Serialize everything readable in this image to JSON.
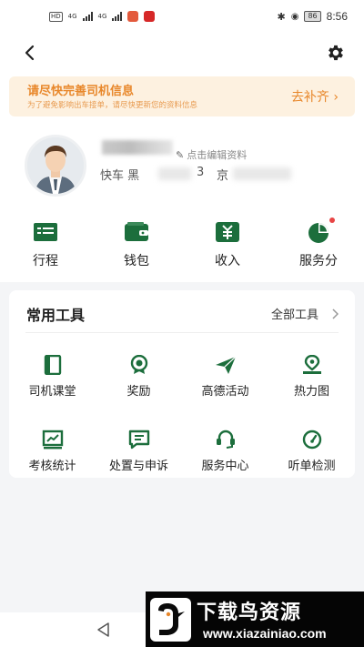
{
  "status_bar": {
    "left_labels": [
      "4G",
      "4G"
    ],
    "time": "8:56",
    "battery": "86"
  },
  "header": {
    "back_icon": "chevron-left-icon",
    "settings_icon": "gear-icon"
  },
  "banner": {
    "title": "请尽快完善司机信息",
    "subtitle": "为了避免影响出车接单，请尽快更新您的资料信息",
    "action": "去补齐 ›"
  },
  "profile": {
    "edit_label": "点击编辑资料",
    "car_visible_text": "快车  黑",
    "car_text_2": "3",
    "car_text_3": "京"
  },
  "quick_actions": [
    {
      "label": "行程",
      "icon": "trip-icon"
    },
    {
      "label": "钱包",
      "icon": "wallet-icon"
    },
    {
      "label": "收入",
      "icon": "income-icon"
    },
    {
      "label": "服务分",
      "icon": "service-score-icon"
    }
  ],
  "tools": {
    "title": "常用工具",
    "all_label": "全部工具",
    "items": [
      {
        "label": "司机课堂",
        "icon": "book-icon"
      },
      {
        "label": "奖励",
        "icon": "award-icon"
      },
      {
        "label": "高德活动",
        "icon": "paper-plane-icon"
      },
      {
        "label": "热力图",
        "icon": "map-pin-icon"
      },
      {
        "label": "考核统计",
        "icon": "chart-icon"
      },
      {
        "label": "处置与申诉",
        "icon": "message-icon"
      },
      {
        "label": "服务中心",
        "icon": "headset-icon"
      },
      {
        "label": "听单检测",
        "icon": "gauge-icon"
      }
    ]
  },
  "colors": {
    "accent_green": "#1c6e3c",
    "banner_orange": "#e8872a",
    "banner_bg": "#fdf1e0",
    "badge_red": "#e84545"
  },
  "watermark": {
    "main": "下载鸟资源",
    "url": "www.xiazainiao.com"
  }
}
